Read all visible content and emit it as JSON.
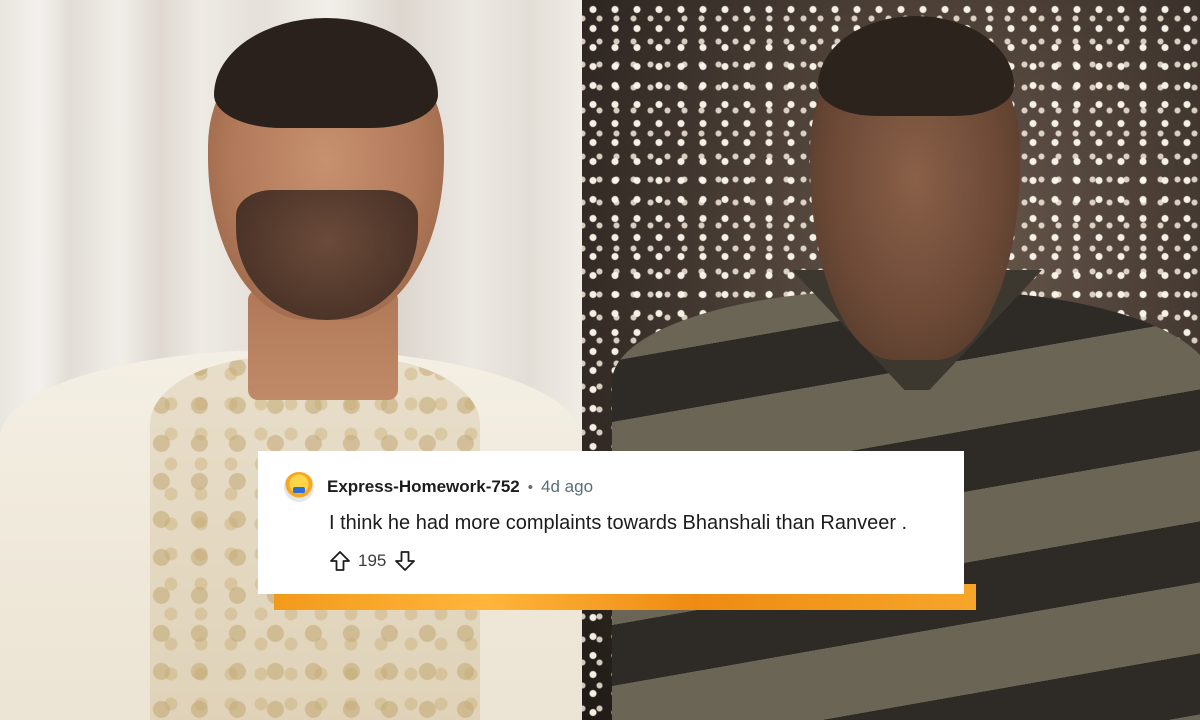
{
  "comment": {
    "username": "Express-Homework-752",
    "separator": "•",
    "timestamp": "4d ago",
    "body": "I think he had more complaints towards Bhanshali than Ranveer .",
    "votes": "195",
    "upvote_icon": "arrow-up-outline-icon",
    "downvote_icon": "arrow-down-outline-icon",
    "avatar_icon": "snoo-avatar-icon"
  },
  "colors": {
    "accent_strip": "#f29a1c",
    "card_background": "#ffffff",
    "text_primary": "#1c1c1c",
    "text_muted": "#576f76"
  }
}
